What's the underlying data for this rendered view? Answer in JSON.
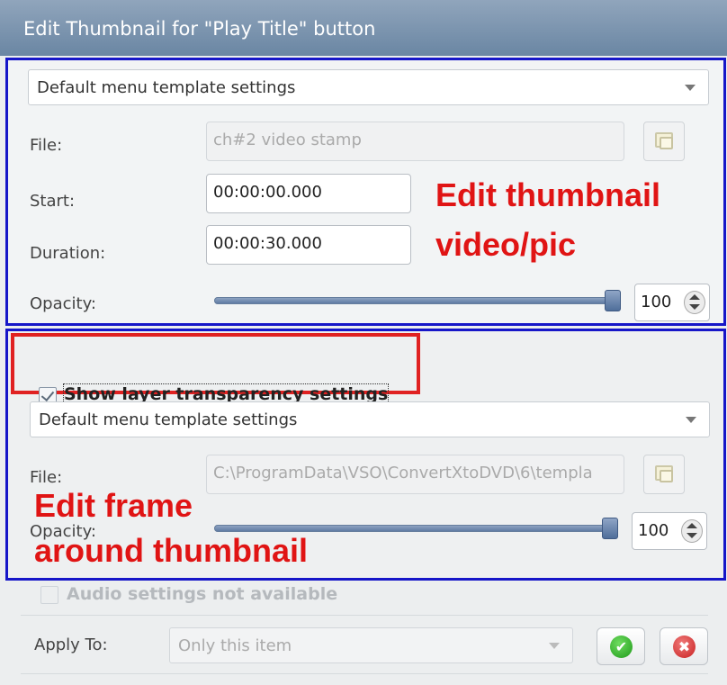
{
  "window": {
    "title": "Edit Thumbnail for \"Play Title\" button"
  },
  "thumbnail_section": {
    "template_value": "Default menu template settings",
    "file_label": "File:",
    "file_value": "ch#2 video stamp",
    "start_label": "Start:",
    "start_value": "00:00:00.000",
    "duration_label": "Duration:",
    "duration_value": "00:00:30.000",
    "opacity_label": "Opacity:",
    "opacity_value": "100",
    "opacity_level": 1.0,
    "annotation_line1": "Edit thumbnail",
    "annotation_line2": "video/pic"
  },
  "frame_section": {
    "show_layer_label": "Show layer transparency settings",
    "show_layer_checked": true,
    "template_value": "Default menu template settings",
    "file_label": "File:",
    "file_value": "C:\\ProgramData\\VSO\\ConvertXtoDVD\\6\\templa",
    "opacity_label": "Opacity:",
    "opacity_value": "100",
    "opacity_level": 1.0,
    "annotation_line1": "Edit frame",
    "annotation_line2": "around thumbnail"
  },
  "audio": {
    "label": "Audio settings not available",
    "checked": false
  },
  "footer": {
    "apply_label": "Apply To:",
    "apply_value": "Only this item",
    "ok_icon": "check-icon",
    "cancel_icon": "close-icon"
  },
  "colors": {
    "annotation_red": "#e01414",
    "section_border_blue": "#1616c8",
    "title_bar": "#7d95b0"
  }
}
